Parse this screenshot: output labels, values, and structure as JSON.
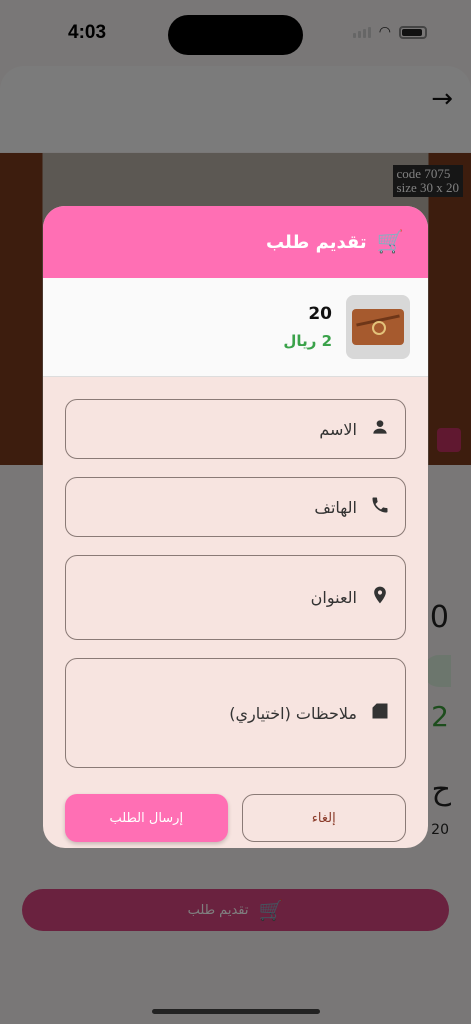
{
  "status_bar": {
    "time": "4:03"
  },
  "background": {
    "product_code_line1": "code 7075",
    "product_code_line2": "size 30 x 20",
    "partial_texts": [
      "0",
      "2",
      "ح",
      "20"
    ],
    "bottom_button_label": "تقديم طلب"
  },
  "dialog": {
    "title": "تقديم طلب",
    "product": {
      "quantity": "20",
      "price": "2 ريال"
    },
    "fields": {
      "name": "الاسم",
      "phone": "الهاتف",
      "address": "العنوان",
      "notes": "ملاحظات (اختياري)"
    },
    "cancel_label": "إلغاء",
    "submit_label": "إرسال الطلب"
  },
  "colors": {
    "header_pink": "#ff6fb4",
    "dialog_bg": "#f7e4e0",
    "price_green": "#3aa24a",
    "cancel_text": "#8a3b2a"
  },
  "icons": [
    "cart-icon",
    "person-icon",
    "phone-icon",
    "location-pin-icon",
    "notes-icon",
    "back-arrow-icon"
  ]
}
